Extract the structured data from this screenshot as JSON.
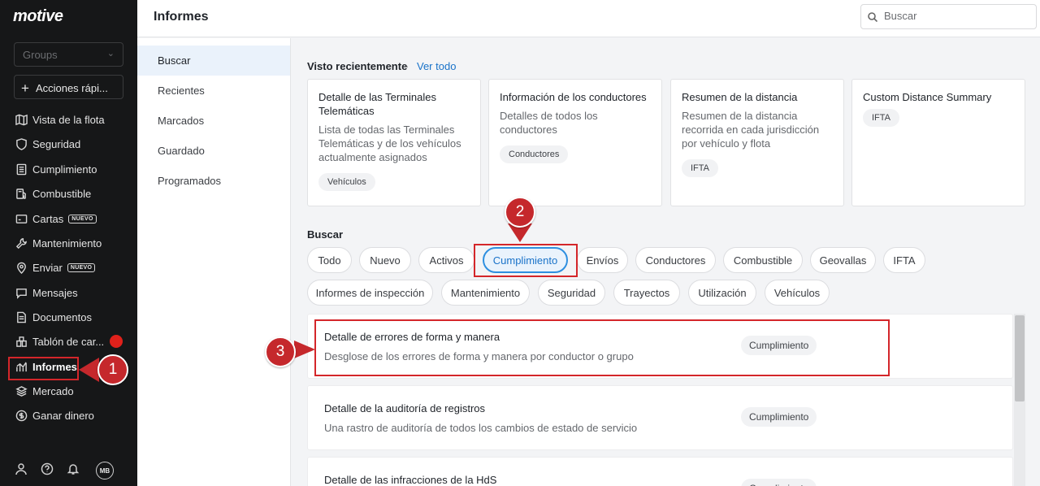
{
  "sidebar": {
    "logo": "motive",
    "groups_placeholder": "Groups",
    "quick_actions": "Acciones rápi...",
    "items": [
      {
        "label": "Vista de la flota",
        "icon": "map-icon"
      },
      {
        "label": "Seguridad",
        "icon": "shield-icon"
      },
      {
        "label": "Cumplimiento",
        "icon": "document-icon"
      },
      {
        "label": "Combustible",
        "icon": "fuel-icon"
      },
      {
        "label": "Cartas",
        "icon": "card-icon",
        "badge": "NUEVO"
      },
      {
        "label": "Mantenimiento",
        "icon": "wrench-icon"
      },
      {
        "label": "Enviar",
        "icon": "location-icon",
        "badge": "NUEVO"
      },
      {
        "label": "Mensajes",
        "icon": "message-icon"
      },
      {
        "label": "Documentos",
        "icon": "file-icon"
      },
      {
        "label": "Tablón de car...",
        "icon": "board-icon"
      },
      {
        "label": "Informes",
        "icon": "reports-icon",
        "active": true
      },
      {
        "label": "Mercado",
        "icon": "layers-icon"
      },
      {
        "label": "Ganar dinero",
        "icon": "dollar-icon"
      }
    ],
    "user_initials": "MB"
  },
  "header": {
    "title": "Informes",
    "search_placeholder": "Buscar"
  },
  "subnav": [
    "Buscar",
    "Recientes",
    "Marcados",
    "Guardado",
    "Programados"
  ],
  "recent": {
    "title": "Visto recientemente",
    "link": "Ver todo",
    "cards": [
      {
        "title": "Detalle de las Terminales Telemáticas",
        "desc": "Lista de todas las Terminales Telemáticas y de los vehículos actualmente asignados",
        "tag": "Vehículos"
      },
      {
        "title": "Información de los conductores",
        "desc": "Detalles de todos los conductores",
        "tag": "Conductores"
      },
      {
        "title": "Resumen de la distancia",
        "desc": "Resumen de la distancia recorrida en cada jurisdicción por vehículo y flota",
        "tag": "IFTA"
      },
      {
        "title": "Custom Distance Summary",
        "desc": "",
        "tag": "IFTA"
      }
    ]
  },
  "search_section": {
    "title": "Buscar",
    "chips_row1": [
      "Todo",
      "Nuevo",
      "Activos",
      "Cumplimiento",
      "Envíos",
      "Conductores",
      "Combustible",
      "Geovallas",
      "IFTA"
    ],
    "chips_row2": [
      "Informes de inspección",
      "Mantenimiento",
      "Seguridad",
      "Trayectos",
      "Utilización",
      "Vehículos"
    ],
    "selected_chip": "Cumplimiento"
  },
  "results": [
    {
      "title": "Detalle de errores de forma y manera",
      "desc": "Desglose de los errores de forma y manera por conductor o grupo",
      "tag": "Cumplimiento"
    },
    {
      "title": "Detalle de la auditoría de registros",
      "desc": "Una rastro de auditoría de todos los cambios de estado de servicio",
      "tag": "Cumplimiento"
    },
    {
      "title": "Detalle de las infracciones de la HdS",
      "desc": "",
      "tag": "Cumplimiento"
    }
  ],
  "annotations": [
    "1",
    "2",
    "3"
  ],
  "colors": {
    "accent": "#1a73c9",
    "annotation": "#c5282c",
    "sidebar": "#161718"
  }
}
